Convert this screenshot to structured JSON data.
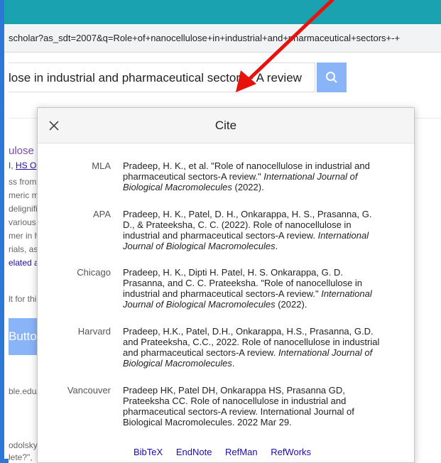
{
  "browser": {
    "url": "scholar?as_sdt=2007&q=Role+of+nanocellulose+in+industrial+and+pharmaceutical+sectors+-+"
  },
  "search": {
    "query": "lose in industrial and pharmaceutical sectors - A review"
  },
  "background": {
    "result_title": "ulose i",
    "authors_prefix": "I, ",
    "authors_link": "HS O",
    "snippet_lines": [
      "ss from",
      "meric m",
      "delignifi",
      "various",
      "mer in h",
      "rials, as"
    ],
    "related": "elated a",
    "result_for": "lt for thi",
    "button_label": "Button",
    "source_url": "ble.edu/",
    "bottom_lines": [
      "odolsky",
      "lete?\","
    ]
  },
  "dialog": {
    "title": "Cite",
    "citations": [
      {
        "style": "MLA",
        "before": "Pradeep, H. K., et al. \"Role of nanocellulose in industrial and pharmaceutical sectors-A review.\" ",
        "journal": "International Journal of Biological Macromolecules",
        "after": " (2022)."
      },
      {
        "style": "APA",
        "before": "Pradeep, H. K., Patel, D. H., Onkarappa, H. S., Prasanna, G. D., & Prateeksha, C. C. (2022). Role of nanocellulose in industrial and pharmaceutical sectors-A review. ",
        "journal": "International Journal of Biological Macromolecules",
        "after": "."
      },
      {
        "style": "Chicago",
        "before": "Pradeep, H. K., Dipti H. Patel, H. S. Onkarappa, G. D. Prasanna, and C. C. Prateeksha. \"Role of nanocellulose in industrial and pharmaceutical sectors-A review.\" ",
        "journal": "International Journal of Biological Macromolecules",
        "after": " (2022)."
      },
      {
        "style": "Harvard",
        "before": "Pradeep, H.K., Patel, D.H., Onkarappa, H.S., Prasanna, G.D. and Prateeksha, C.C., 2022. Role of nanocellulose in industrial and pharmaceutical sectors-A review. ",
        "journal": "International Journal of Biological Macromolecules",
        "after": "."
      },
      {
        "style": "Vancouver",
        "before": "Pradeep HK, Patel DH, Onkarappa HS, Prasanna GD, Prateeksha CC. Role of nanocellulose in industrial and pharmaceutical sectors-A review. International Journal of Biological Macromolecules. 2022 Mar 29.",
        "journal": "",
        "after": ""
      }
    ],
    "exports": [
      "BibTeX",
      "EndNote",
      "RefMan",
      "RefWorks"
    ]
  },
  "colors": {
    "tabstrip": "#1aa2b1",
    "frame": "#2d78d6",
    "link": "#1a0dab",
    "search_button": "#8ab4f8",
    "annotation_arrow": "#e8120c"
  }
}
